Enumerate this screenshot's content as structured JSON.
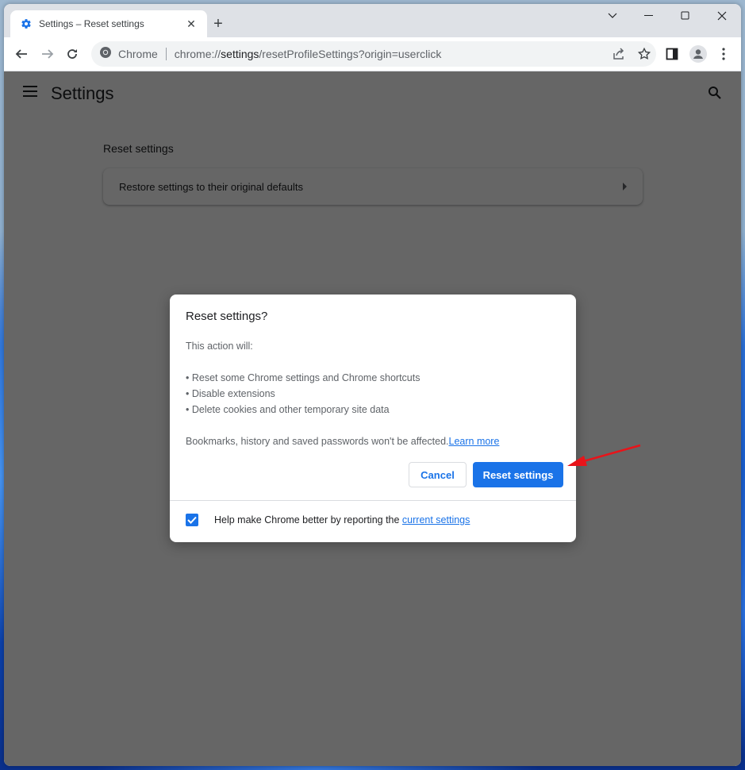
{
  "browser": {
    "tab": {
      "title": "Settings – Reset settings",
      "icon": "gear-icon",
      "close_glyph": "✕"
    },
    "new_tab_glyph": "+",
    "window_controls": [
      "tab-search",
      "minimize",
      "maximize",
      "close"
    ],
    "omnibox": {
      "chip_label": "Chrome",
      "url_prefix": "chrome://",
      "url_host": "settings",
      "url_path": "/resetProfileSettings?origin=userclick"
    }
  },
  "settings": {
    "header_title": "Settings",
    "section_title": "Reset settings",
    "card_label": "Restore settings to their original defaults"
  },
  "dialog": {
    "title": "Reset settings?",
    "intro": "This action will:",
    "bullets": [
      "• Reset some Chrome settings and Chrome shortcuts",
      "• Disable extensions",
      "• Delete cookies and other temporary site data"
    ],
    "note": "Bookmarks, history and saved passwords won't be affected.",
    "learn_more": "Learn more",
    "cancel_label": "Cancel",
    "reset_label": "Reset settings",
    "footer_text": "Help make Chrome better by reporting the ",
    "footer_link": "current settings",
    "checkbox_checked": true
  },
  "colors": {
    "accent": "#1a73e8",
    "annotation_arrow": "#e8141a"
  }
}
